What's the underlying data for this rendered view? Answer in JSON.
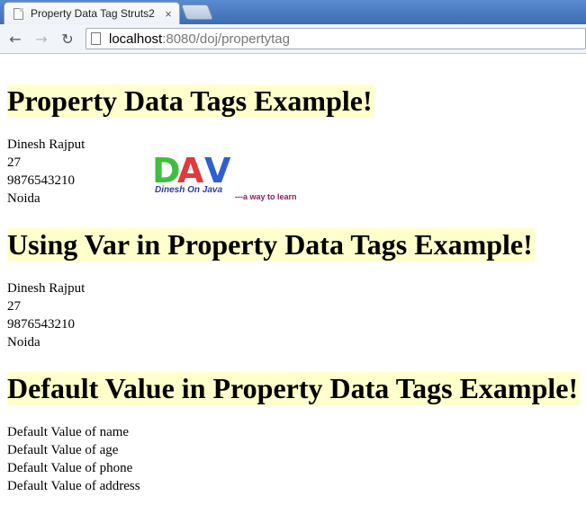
{
  "browser": {
    "tab_title": "Property Data Tag Struts2",
    "tab_close": "×",
    "url_host": "localhost",
    "url_rest": ":8080/doj/propertytag"
  },
  "section1": {
    "heading": "Property Data Tags Example!",
    "lines": [
      "Dinesh Rajput",
      "27",
      "9876543210",
      "Noida"
    ]
  },
  "logo": {
    "letters": "DAV",
    "caption": "Dinesh On Java",
    "tagline": "---a way to learn",
    "colors": {
      "d": "#3fbf3f",
      "a": "#e03a3a",
      "v": "#2f5fd0",
      "caption": "#2a3d9a",
      "tagline": "#8a1c5a"
    }
  },
  "section2": {
    "heading": "Using Var in Property Data Tags Example!",
    "lines": [
      "Dinesh Rajput",
      "27",
      "9876543210",
      "Noida"
    ]
  },
  "section3": {
    "heading": "Default Value in Property Data Tags Example!",
    "lines": [
      "Default Value of name",
      "Default Value of age",
      "Default Value of phone",
      "Default Value of address"
    ]
  },
  "colors": {
    "heading_bg": "#ffffcc"
  }
}
